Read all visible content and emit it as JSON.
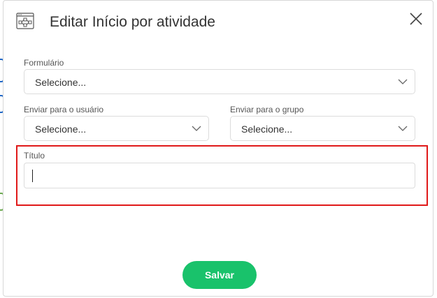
{
  "modal": {
    "title": "Editar Início por atividade",
    "header_icon": "workflow-diagram-icon",
    "close_icon": "close-icon"
  },
  "form": {
    "formulario": {
      "label": "Formulário",
      "value": "Selecione..."
    },
    "enviar_usuario": {
      "label": "Enviar para o usuário",
      "value": "Selecione..."
    },
    "enviar_grupo": {
      "label": "Enviar para o grupo",
      "value": "Selecione..."
    },
    "titulo": {
      "label": "Título",
      "value": ""
    }
  },
  "actions": {
    "save_label": "Salvar"
  },
  "colors": {
    "primary_button": "#19c26b",
    "highlight_border": "#e01919",
    "input_border": "#dcdcdc",
    "title_text": "#333333"
  }
}
